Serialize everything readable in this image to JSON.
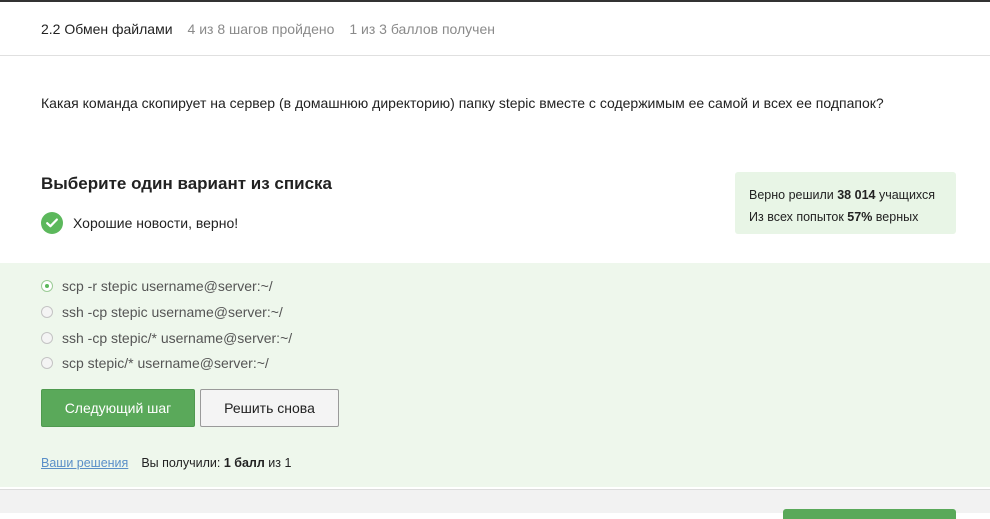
{
  "header": {
    "lesson_title": "2.2 Обмен файлами",
    "steps_progress": "4 из 8 шагов пройдено",
    "points_progress": "1 из 3 баллов  получен"
  },
  "question": {
    "text": "Какая команда скопирует на сервер (в домашнюю директорию) папку stepic вместе с содержимым ее самой и всех ее подпапок?"
  },
  "quiz": {
    "instruction": "Выберите один вариант из списка",
    "feedback": "Хорошие новости, верно!",
    "options": [
      {
        "label": "scp -r stepic username@server:~/",
        "selected": true
      },
      {
        "label": "ssh -cp stepic username@server:~/",
        "selected": false
      },
      {
        "label": "ssh -cp stepic/* username@server:~/",
        "selected": false
      },
      {
        "label": "scp stepic/* username@server:~/",
        "selected": false
      }
    ]
  },
  "stats": {
    "solved_prefix": "Верно решили ",
    "solved_count": "38 014",
    "solved_suffix": " учащихся",
    "attempts_prefix": "Из всех попыток ",
    "attempts_percent": "57%",
    "attempts_suffix": " верных"
  },
  "buttons": {
    "next_label": "Следующий шаг",
    "retry_label": "Решить снова"
  },
  "footer": {
    "solutions_link": "Ваши решения",
    "score_prefix": "Вы получили: ",
    "score_value": "1 балл",
    "score_suffix": " из 1"
  },
  "colors": {
    "accent_green": "#5aa95a",
    "answer_bg": "#eef7ec",
    "stats_bg": "#e8f5e6"
  }
}
